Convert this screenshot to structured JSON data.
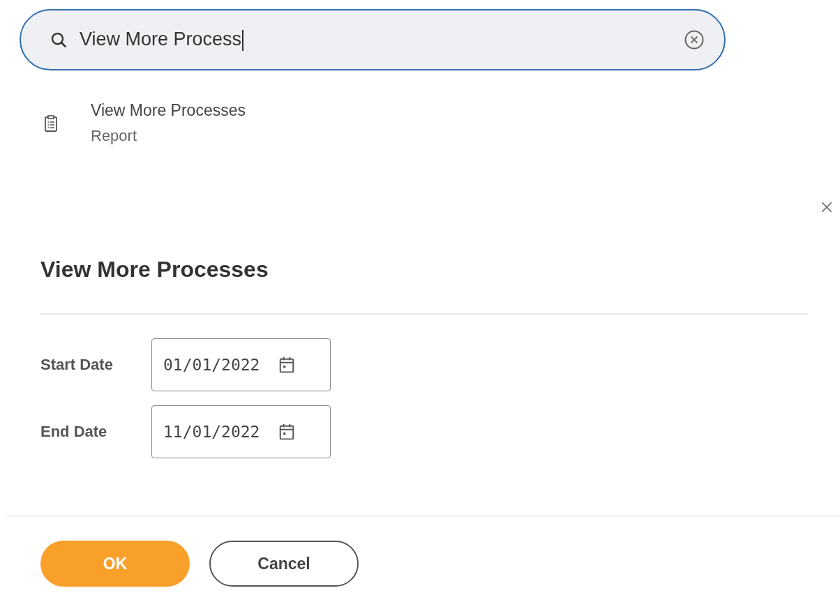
{
  "search": {
    "value": "View More Process"
  },
  "results": [
    {
      "title": "View More Processes",
      "subtitle": "Report"
    }
  ],
  "dialog": {
    "title": "View More Processes",
    "fields": [
      {
        "label": "Start Date",
        "value": "01/01/2022"
      },
      {
        "label": "End Date",
        "value": "11/01/2022"
      }
    ],
    "buttons": [
      {
        "label": "OK",
        "kind": "primary"
      },
      {
        "label": "Cancel",
        "kind": "secondary"
      }
    ]
  }
}
